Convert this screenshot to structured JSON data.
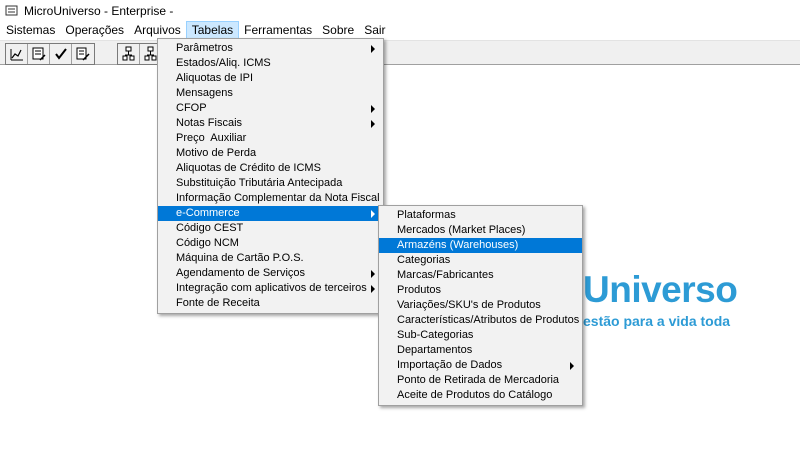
{
  "window": {
    "title": "MicroUniverso - Enterprise -"
  },
  "menubar": {
    "items": [
      {
        "label": "Sistemas"
      },
      {
        "label": "Operações"
      },
      {
        "label": "Arquivos"
      },
      {
        "label": "Tabelas"
      },
      {
        "label": "Ferramentas"
      },
      {
        "label": "Sobre"
      },
      {
        "label": "Sair"
      }
    ],
    "active": "Tabelas"
  },
  "toolbar": {
    "icons": [
      "chart-edit-icon",
      "list-edit-icon",
      "checkmark-icon",
      "document-edit-icon",
      "tree-icon",
      "tree-icon-2"
    ]
  },
  "tabelas_menu": {
    "items": [
      {
        "label": "Parâmetros",
        "submenu": true
      },
      {
        "label": "Estados/Aliq. ICMS",
        "submenu": false
      },
      {
        "label": "Aliquotas de IPI",
        "submenu": false
      },
      {
        "label": "Mensagens",
        "submenu": false
      },
      {
        "label": "CFOP",
        "submenu": true
      },
      {
        "label": "Notas Fiscais",
        "submenu": true
      },
      {
        "label": "Preço  Auxiliar",
        "submenu": false
      },
      {
        "label": "Motivo de Perda",
        "submenu": false
      },
      {
        "label": "Aliquotas de Crédito de ICMS",
        "submenu": false
      },
      {
        "label": "Substituição Tributária Antecipada",
        "submenu": false
      },
      {
        "label": "Informação Complementar da Nota Fiscal",
        "submenu": false
      },
      {
        "label": "e-Commerce",
        "submenu": true,
        "highlighted": true
      },
      {
        "label": "Código CEST",
        "submenu": false
      },
      {
        "label": "Código NCM",
        "submenu": false
      },
      {
        "label": "Máquina de Cartão P.O.S.",
        "submenu": false
      },
      {
        "label": "Agendamento de Serviços",
        "submenu": true
      },
      {
        "label": "Integração com aplicativos de terceiros",
        "submenu": true
      },
      {
        "label": "Fonte de Receita",
        "submenu": false
      }
    ]
  },
  "ecommerce_menu": {
    "items": [
      {
        "label": "Plataformas",
        "submenu": false
      },
      {
        "label": "Mercados (Market Places)",
        "submenu": false
      },
      {
        "label": "Armazéns (Warehouses)",
        "submenu": false,
        "highlighted": true
      },
      {
        "label": "Categorias",
        "submenu": false
      },
      {
        "label": "Marcas/Fabricantes",
        "submenu": false
      },
      {
        "label": "Produtos",
        "submenu": false
      },
      {
        "label": "Variações/SKU's de Produtos",
        "submenu": false
      },
      {
        "label": "Características/Atributos de Produtos",
        "submenu": false
      },
      {
        "label": "Sub-Categorias",
        "submenu": false
      },
      {
        "label": "Departamentos",
        "submenu": false
      },
      {
        "label": "Importação de Dados",
        "submenu": true
      },
      {
        "label": "Ponto de Retirada de Mercadoria",
        "submenu": false
      },
      {
        "label": "Aceite de Produtos do Catálogo",
        "submenu": false
      }
    ]
  },
  "logo": {
    "word": "Universo",
    "slogan": "estão para a vida toda",
    "color": "#2d9bd5"
  },
  "colors": {
    "highlight": "#0078d7",
    "menu_bg": "#f2f2f2",
    "menubar_active": "#cce8ff"
  }
}
